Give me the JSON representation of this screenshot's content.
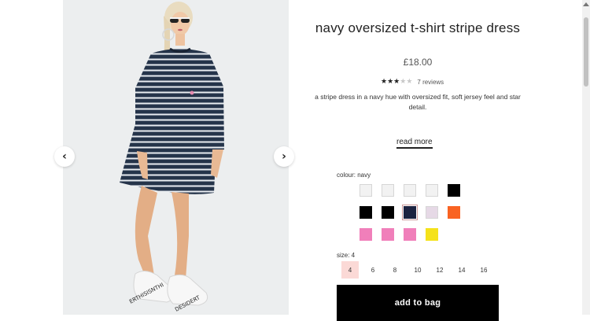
{
  "product": {
    "title": "navy oversized t-shirt stripe dress",
    "price": "£18.00",
    "rating": 3,
    "rating_max": 5,
    "reviews": "7 reviews",
    "description": "a stripe dress in a navy hue with oversized fit, soft jersey feel and star detail.",
    "read_more": "read more"
  },
  "gallery": {
    "prev_icon": "‹",
    "next_icon": "›",
    "sneaker_text_left": "ERTHISISNTHI",
    "sneaker_text_right": "DESIDERT"
  },
  "colour": {
    "label": "colour: navy",
    "swatches": [
      "#f2f2f2",
      "#f2f2f2",
      "#f2f2f2",
      "#f2f2f2",
      "#000000",
      "#000000",
      "#000000",
      "#1c2340",
      "#e6d9e6",
      "#f96322",
      "#f07fba",
      "#f07fba",
      "#f07fba",
      "#f5e21a"
    ],
    "selected_index": 7
  },
  "size": {
    "label": "size: 4",
    "options": [
      "4",
      "6",
      "8",
      "10",
      "12",
      "14",
      "16"
    ],
    "selected": "4"
  },
  "add_to_bag": "add to bag",
  "colors": {
    "accent_pink": "#fbd9d6",
    "button_black": "#000000",
    "gallery_bg": "#eceeef"
  }
}
